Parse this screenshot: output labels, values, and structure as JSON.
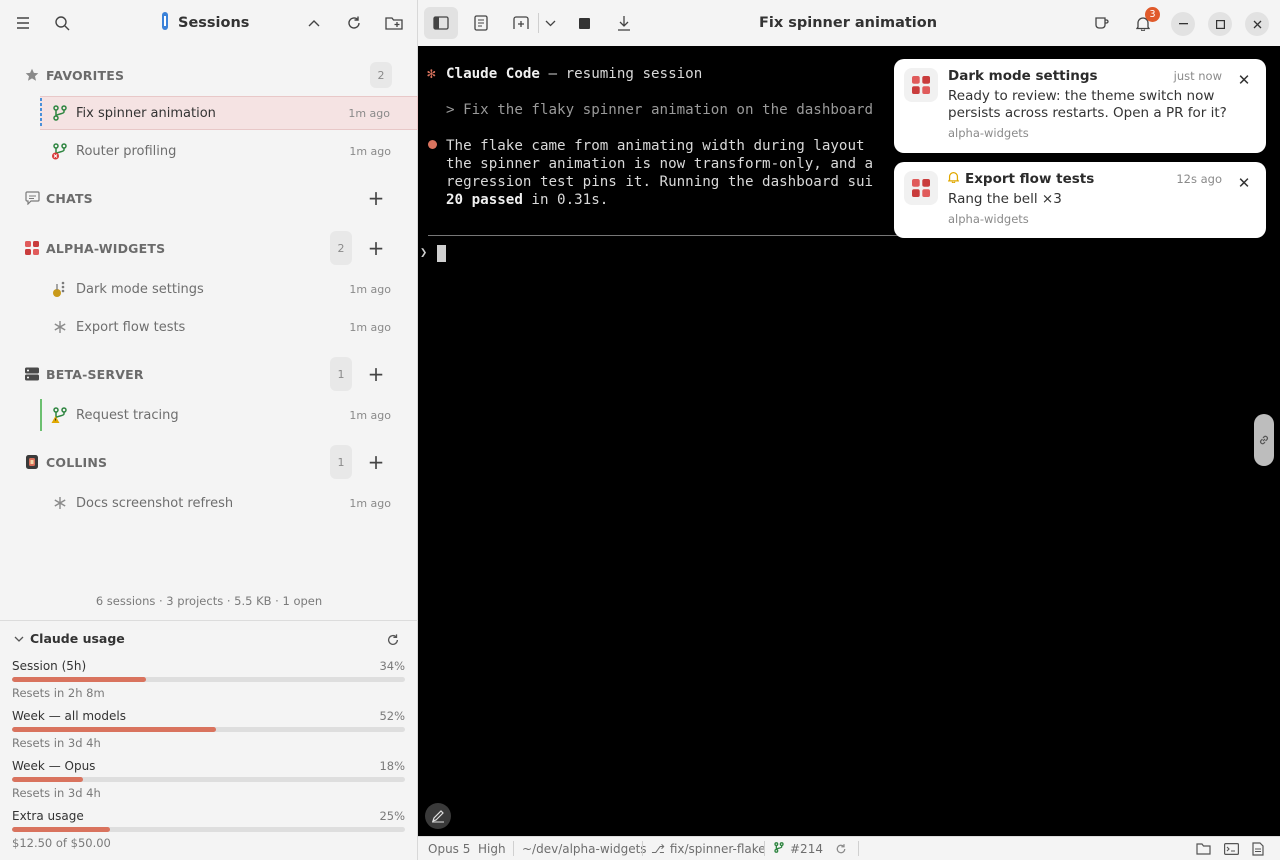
{
  "sidebar": {
    "title": "Sessions",
    "groups": [
      {
        "label": "FAVORITES",
        "count": "2"
      },
      {
        "label": "CHATS"
      },
      {
        "label": "ALPHA-WIDGETS",
        "count": "2"
      },
      {
        "label": "BETA-SERVER",
        "count": "1"
      },
      {
        "label": "COLLINS",
        "count": "1"
      }
    ],
    "sessions": [
      {
        "label": "Fix spinner animation",
        "time": "1m ago"
      },
      {
        "label": "Router profiling",
        "time": "1m ago"
      },
      {
        "label": "Dark mode settings",
        "time": "1m ago"
      },
      {
        "label": "Export flow tests",
        "time": "1m ago"
      },
      {
        "label": "Request tracing",
        "time": "1m ago"
      },
      {
        "label": "Docs screenshot refresh",
        "time": "1m ago"
      }
    ],
    "summary": "6 sessions · 3 projects · 5.5 KB · 1 open"
  },
  "usage": {
    "title": "Claude usage",
    "rows": [
      {
        "label": "Session (5h)",
        "pct": "34%",
        "fraction": 0.34,
        "sub": "Resets in 2h 8m"
      },
      {
        "label": "Week — all models",
        "pct": "52%",
        "fraction": 0.52,
        "sub": "Resets in 3d 4h"
      },
      {
        "label": "Week — Opus",
        "pct": "18%",
        "fraction": 0.18,
        "sub": "Resets in 3d 4h"
      },
      {
        "label": "Extra usage",
        "pct": "25%",
        "fraction": 0.25,
        "sub": "$12.50 of $50.00"
      }
    ]
  },
  "main": {
    "title": "Fix spinner animation",
    "notification_count": "3"
  },
  "terminal": {
    "brand": "Claude Code",
    "resume_text": " — resuming session",
    "prompt_line": "> Fix the flaky spinner animation on the dashboard",
    "reply_line1": "The flake came from animating width during layout",
    "reply_line2": "the spinner animation is now transform-only, and a",
    "reply_line3": "regression test pins it. Running the dashboard sui",
    "reply_bold": "20 passed",
    "reply_tail": " in 0.31s.",
    "input_prompt": "❯"
  },
  "notifications": [
    {
      "title": "Dark mode settings",
      "time": "just now",
      "body": "Ready to review: the theme switch now persists across restarts. Open a PR for it?",
      "source": "alpha-widgets"
    },
    {
      "title": "Export flow tests",
      "time": "12s ago",
      "body": "Rang the bell ×3",
      "source": "alpha-widgets"
    }
  ],
  "status": {
    "model": "Opus 5",
    "effort": "High",
    "path": "~/dev/alpha-widgets",
    "branch": "fix/spinner-flake",
    "pr": "#214"
  },
  "colors": {
    "accent": "#d9735e",
    "active_row": "#f5e3e3",
    "git_green": "#2e8540",
    "error_red": "#d93838",
    "warning_yellow": "#e0a800",
    "badge_orange": "#e05a2b"
  }
}
